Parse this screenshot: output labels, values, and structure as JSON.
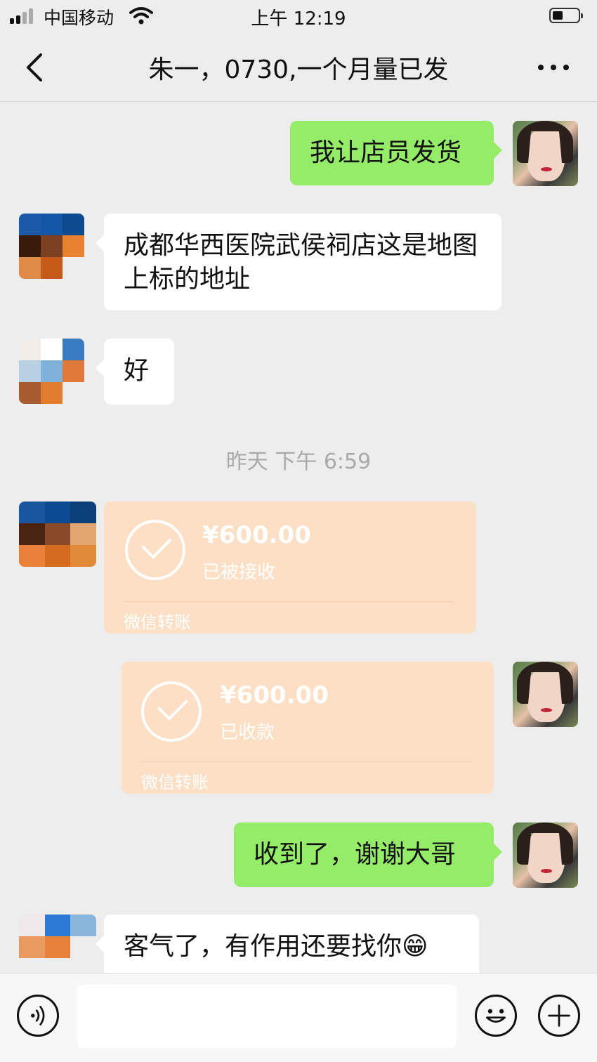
{
  "status_bar": {
    "carrier": "中国移动",
    "time": "上午 12:19"
  },
  "nav": {
    "title": "朱一，0730,一个月量已发",
    "more": "···"
  },
  "messages": {
    "m1": "我让店员发货",
    "m2": "成都华西医院武侯祠店这是地图上标的地址",
    "m3": "好",
    "timestamp": "昨天 下午 6:59",
    "t1": {
      "amount": "¥600.00",
      "status": "已被接收",
      "label": "微信转账"
    },
    "t2": {
      "amount": "¥600.00",
      "status": "已收款",
      "label": "微信转账"
    },
    "m4": "收到了，谢谢大哥",
    "m5": "客气了，有作用还要找你😁"
  },
  "colors": {
    "chat_bg": "#ededed",
    "my_bubble": "#95ec69",
    "other_bubble": "#ffffff",
    "transfer_bg": "#fcdfc4"
  },
  "icons": {
    "back": "chevron-left-icon",
    "more": "ellipsis-icon",
    "voice": "voice-icon",
    "emoji": "smile-icon",
    "plus": "plus-icon",
    "check": "check-circle-icon"
  }
}
